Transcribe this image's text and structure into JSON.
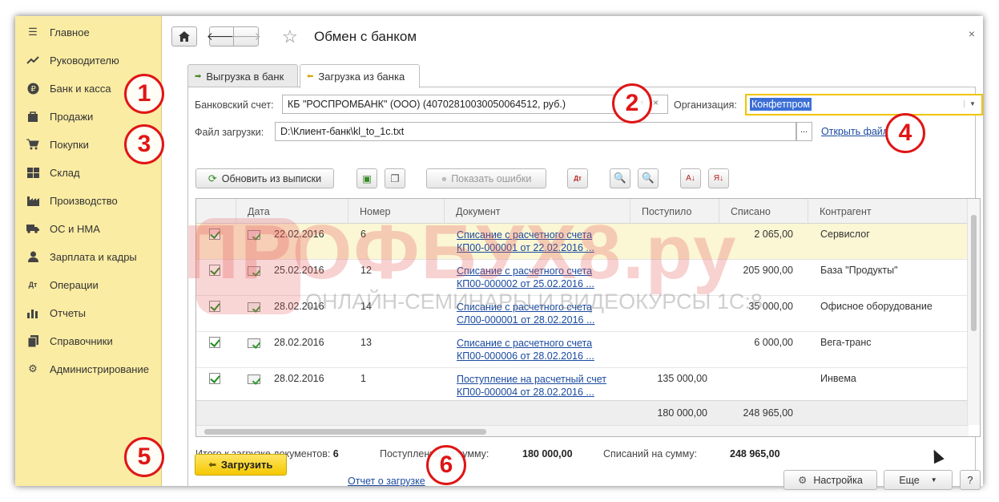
{
  "sidebar": {
    "items": [
      {
        "label": "Главное",
        "icon": "menu-icon"
      },
      {
        "label": "Руководителю",
        "icon": "trend-icon"
      },
      {
        "label": "Банк и касса",
        "icon": "ruble-icon"
      },
      {
        "label": "Продажи",
        "icon": "bag-icon"
      },
      {
        "label": "Покупки",
        "icon": "cart-icon"
      },
      {
        "label": "Склад",
        "icon": "warehouse-icon"
      },
      {
        "label": "Производство",
        "icon": "factory-icon"
      },
      {
        "label": "ОС и НМА",
        "icon": "truck-icon"
      },
      {
        "label": "Зарплата и кадры",
        "icon": "person-icon"
      },
      {
        "label": "Операции",
        "icon": "dtkt-icon"
      },
      {
        "label": "Отчеты",
        "icon": "barchart-icon"
      },
      {
        "label": "Справочники",
        "icon": "books-icon"
      },
      {
        "label": "Администрирование",
        "icon": "gear-icon"
      }
    ]
  },
  "header": {
    "title": "Обмен с банком",
    "close": "×"
  },
  "tabs": [
    {
      "label": "Выгрузка в банк",
      "active": false
    },
    {
      "label": "Загрузка из банка",
      "active": true
    }
  ],
  "form": {
    "account_label": "Банковский счет:",
    "account_value": "КБ \"РОСПРОМБАНК\" (ООО) (40702810030050064512, руб.)",
    "org_label": "Организация:",
    "org_value": "Конфетпром",
    "file_label": "Файл загрузки:",
    "file_value": "D:\\Клиент-банк\\kl_to_1c.txt",
    "browse": "...",
    "open_file": "Открыть файл"
  },
  "toolbar": {
    "refresh": "Обновить из выписки",
    "show_errors": "Показать ошибки"
  },
  "table": {
    "columns": [
      "Дата",
      "Номер",
      "Документ",
      "Поступило",
      "Списано",
      "Контрагент"
    ],
    "rows": [
      {
        "date": "22.02.2016",
        "number": "6",
        "doc1": "Списание с расчетного счета",
        "doc2": "КП00-000001 от 22.02.2016 ...",
        "in": "",
        "out": "2 065,00",
        "contractor": "Сервислог"
      },
      {
        "date": "25.02.2016",
        "number": "12",
        "doc1": "Списание с расчетного счета",
        "doc2": "КП00-000002 от 25.02.2016 ...",
        "in": "",
        "out": "205 900,00",
        "contractor": "База \"Продукты\""
      },
      {
        "date": "28.02.2016",
        "number": "14",
        "doc1": "Списание с расчетного счета",
        "doc2": "СЛ00-000001 от 28.02.2016 ...",
        "in": "",
        "out": "35 000,00",
        "contractor": "Офисное оборудование"
      },
      {
        "date": "28.02.2016",
        "number": "13",
        "doc1": "Списание с расчетного счета",
        "doc2": "КП00-000006 от 28.02.2016 ...",
        "in": "",
        "out": "6 000,00",
        "contractor": "Вега-транс"
      },
      {
        "date": "28.02.2016",
        "number": "1",
        "doc1": "Поступление на расчетный счет",
        "doc2": "КП00-000004 от 28.02.2016 ...",
        "in": "135 000,00",
        "out": "",
        "contractor": "Инвема"
      }
    ],
    "total_in": "180 000,00",
    "total_out": "248 965,00"
  },
  "footer": {
    "docs_label": "Итого к загрузке документов:",
    "docs_value": "6",
    "in_label": "Поступлений на сумму:",
    "in_value": "180 000,00",
    "out_label": "Списаний на сумму:",
    "out_value": "248 965,00",
    "load": "Загрузить",
    "report": "Отчет о загрузке",
    "settings": "Настройка",
    "more": "Еще",
    "help": "?"
  },
  "markers": [
    "1",
    "2",
    "3",
    "4",
    "5",
    "6"
  ],
  "watermark": {
    "brand": "ПРОФБУХ8.ру",
    "tagline": "ОНЛАЙН-СЕМИНАРЫ И ВИДЕОКУРСЫ 1С:8"
  },
  "colors": {
    "sidebar": "#fbeca3",
    "accent_yellow": "#f4c800",
    "link": "#1a4aa0",
    "marker": "#e01515"
  }
}
